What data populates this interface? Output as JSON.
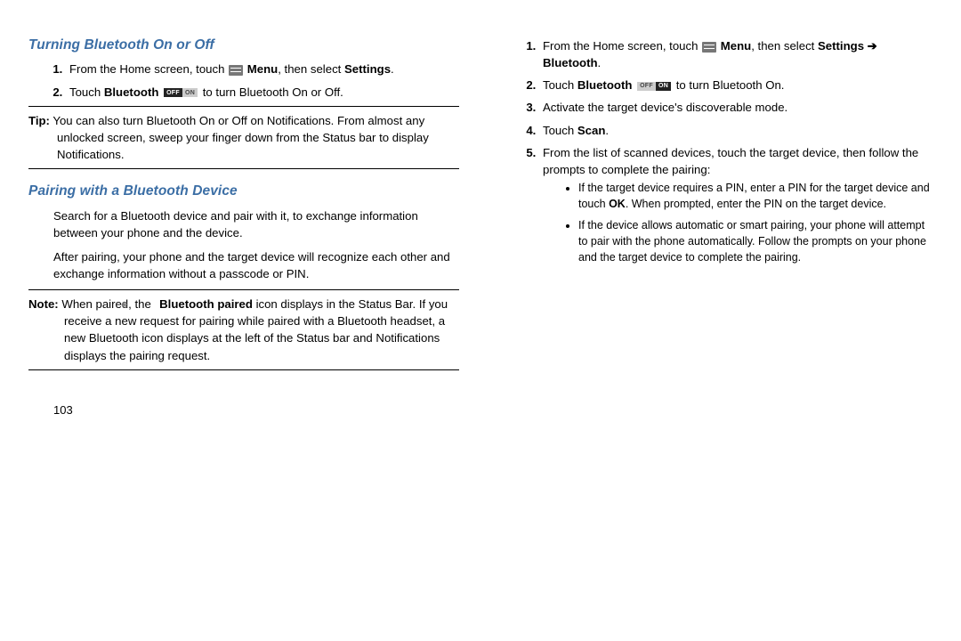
{
  "left": {
    "h1": "Turning Bluetooth On or Off",
    "step1_a": "From the Home screen, touch ",
    "step1_b": " Menu",
    "step1_c": ", then select ",
    "step1_d": "Settings",
    "step1_e": ".",
    "step2_a": "Touch ",
    "step2_b": "Bluetooth",
    "step2_c": " to turn Bluetooth On or Off.",
    "toggle_off": "OFF",
    "toggle_on": "ON",
    "tip_label": "Tip:",
    "tip_body": " You can also turn Bluetooth On or Off on Notifications. From almost any unlocked screen, sweep your finger down from the Status bar to display Notifications.",
    "h2": "Pairing with a Bluetooth Device",
    "p1": "Search for a Bluetooth device and pair with it, to exchange information between your phone and the device.",
    "p2": "After pairing, your phone and the target device will recognize each other and exchange information without a passcode or PIN.",
    "note_label": "Note:",
    "note_a": " When paired, the ",
    "note_b": " Bluetooth paired",
    "note_c": " icon displays in the Status Bar. If you receive a new request for pairing while paired with a Bluetooth headset, a new Bluetooth icon displays at the left of the Status bar and Notifications displays the pairing request."
  },
  "right": {
    "step1_a": "From the Home screen, touch ",
    "step1_b": " Menu",
    "step1_c": ", then select ",
    "step1_d": "Settings ",
    "arrow": "➔",
    "step1_e": " Bluetooth",
    "step1_f": ".",
    "step2_a": "Touch ",
    "step2_b": "Bluetooth",
    "step2_c": " to turn Bluetooth On.",
    "toggle_off": "OFF",
    "toggle_on": "ON",
    "step3": "Activate the target device's discoverable mode.",
    "step4_a": "Touch ",
    "step4_b": "Scan",
    "step4_c": ".",
    "step5": "From the list of scanned devices, touch the target device, then follow the prompts to complete the pairing:",
    "sub1_a": "If the target device requires a PIN, enter a PIN for the target device and touch ",
    "sub1_b": "OK",
    "sub1_c": ". When prompted, enter the PIN on the target device.",
    "sub2": "If the device allows automatic or smart pairing, your phone will attempt to pair with the phone automatically. Follow the prompts on your phone and the target device to complete the pairing."
  },
  "page_number": "103"
}
